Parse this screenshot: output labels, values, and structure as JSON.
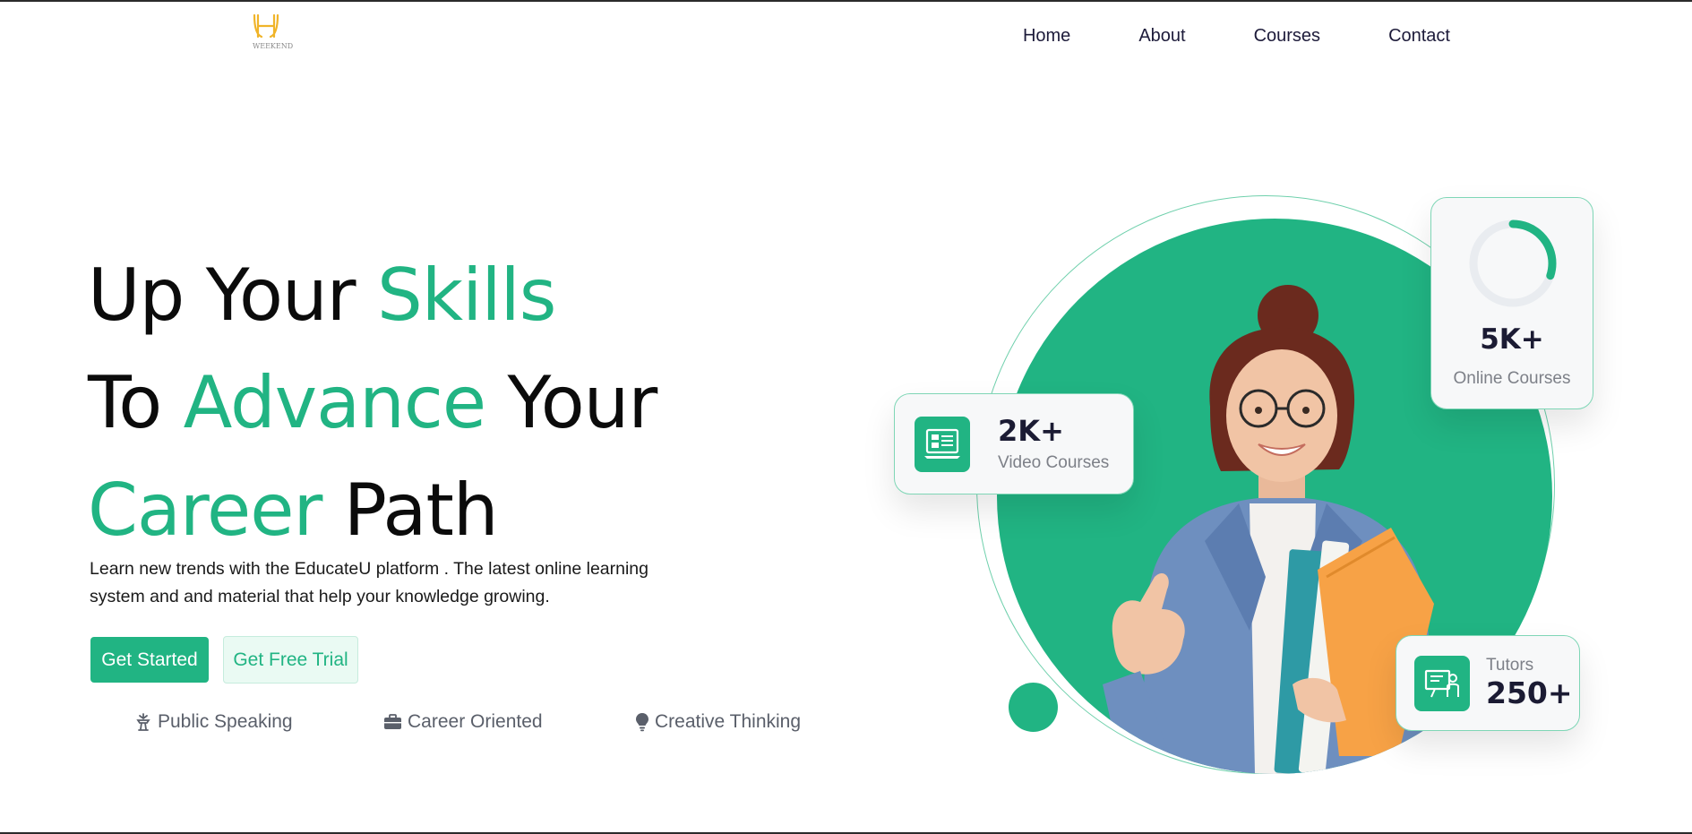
{
  "header": {
    "logo_text": "WEEKEND",
    "nav": [
      "Home",
      "About",
      "Courses",
      "Contact"
    ]
  },
  "hero": {
    "headline": {
      "line1_a": "Up Your ",
      "line1_b": "Skills",
      "line2_a": "To ",
      "line2_b": "Advance",
      "line2_c": " Your",
      "line3_a": "Career",
      "line3_b": " Path"
    },
    "subtext": "Learn new trends with the EducateU platform . The latest online learning system and and material that help your knowledge growing.",
    "buttons": {
      "primary": "Get Started",
      "secondary": "Get Free Trial"
    },
    "features": [
      {
        "label": "Public Speaking",
        "icon": "podium-icon"
      },
      {
        "label": "Career Oriented",
        "icon": "briefcase-icon"
      },
      {
        "label": "Creative Thinking",
        "icon": "lightbulb-icon"
      }
    ]
  },
  "stats": {
    "video": {
      "value": "2K+",
      "label": "Video Courses",
      "icon": "video-course-icon"
    },
    "online": {
      "value": "5K+",
      "label": "Online Courses",
      "progress": 0.3
    },
    "tutors": {
      "label": "Tutors",
      "value": "250+",
      "icon": "tutor-icon"
    }
  },
  "colors": {
    "accent": "#21b483",
    "text_dark": "#0b0b0b",
    "nav_text": "#1d1b3a",
    "muted": "#7d8088",
    "logo": "#f0b429"
  }
}
